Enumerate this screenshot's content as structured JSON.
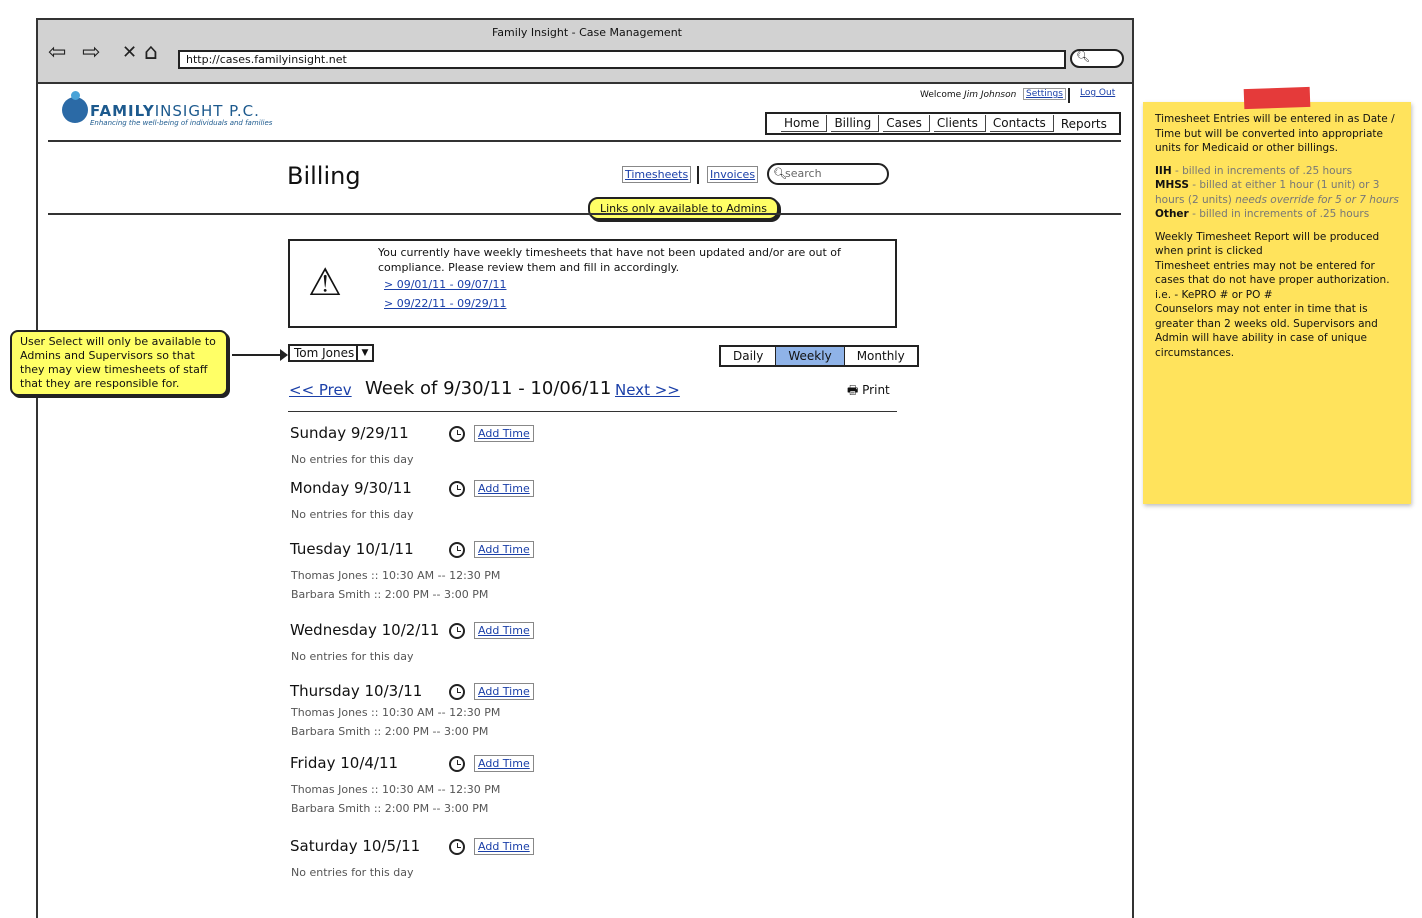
{
  "window": {
    "title": "Family Insight - Case Management",
    "url": "http://cases.familyinsight.net"
  },
  "browser": {
    "back_icon": "⇦",
    "forward_icon": "⇨",
    "stop_icon": "✕",
    "home_icon": "⌂",
    "search_icon": "🔍︎"
  },
  "brand": {
    "name_bold": "FAMILY",
    "name_thin": "INSIGHT P.C.",
    "tagline": "Enhancing the well-being of individuals and families"
  },
  "header": {
    "welcome": "Welcome",
    "user_name": "Jim Johnson",
    "settings": "Settings",
    "logout": "Log Out"
  },
  "nav": {
    "items": [
      "Home",
      "Billing",
      "Cases",
      "Clients",
      "Contacts",
      "Reports"
    ]
  },
  "page": {
    "title": "Billing",
    "timesheets_link": "Timesheets",
    "invoices_link": "Invoices",
    "search_placeholder": "search",
    "admin_note": "Links only available to Admins"
  },
  "alert": {
    "message": "You currently have weekly timesheets that have not been updated and/or are out of compliance. Please review them and fill in accordingly.",
    "links": [
      "> 09/01/11 - 09/07/11",
      "> 09/22/11 - 09/29/11"
    ]
  },
  "user_note": "User Select will only be available to Admins and Supervisors so that they may view timesheets of staff that they are responsible for.",
  "user_select": {
    "value": "Tom Jones"
  },
  "view_toggle": {
    "options": [
      "Daily",
      "Weekly",
      "Monthly"
    ],
    "selected": "Weekly",
    "active_color": "#8fb3e8"
  },
  "week": {
    "prev": "<< Prev",
    "label": "Week of 9/30/11 - 10/06/11",
    "next": "Next >>",
    "print": "Print"
  },
  "add_time_label": "Add Time",
  "days": [
    {
      "title": "Sunday 9/29/11",
      "entries": [
        "No entries for this day"
      ]
    },
    {
      "title": "Monday 9/30/11",
      "entries": [
        "No entries for this day"
      ]
    },
    {
      "title": "Tuesday 10/1/11",
      "entries": [
        "Thomas Jones :: 10:30 AM -- 12:30 PM",
        "Barbara Smith :: 2:00 PM -- 3:00 PM"
      ]
    },
    {
      "title": "Wednesday 10/2/11",
      "entries": [
        "No entries for this day"
      ]
    },
    {
      "title": "Thursday 10/3/11",
      "entries": [
        "Thomas Jones :: 10:30 AM -- 12:30 PM",
        "Barbara Smith :: 2:00 PM -- 3:00 PM"
      ]
    },
    {
      "title": "Friday 10/4/11",
      "entries": [
        "Thomas Jones :: 10:30 AM -- 12:30 PM",
        "Barbara Smith :: 2:00 PM -- 3:00 PM"
      ]
    },
    {
      "title": "Saturday 10/5/11",
      "entries": [
        "No entries for this day"
      ]
    }
  ],
  "sticky": {
    "intro": "Timesheet Entries will be entered in as Date / Time but will be converted into appropriate units for Medicaid or other billings.",
    "iih_label": "IIH",
    "iih_text": " - billed in increments of .25 hours",
    "mhss_label": "MHSS",
    "mhss_text": " - billed at either 1 hour (1 unit) or 3 hours (2 units) ",
    "mhss_italic": "needs override for 5 or 7 hours",
    "other_label": "Other",
    "other_text": " - billed in increments of .25 hours",
    "report": "Weekly Timesheet Report will be produced when print is clicked",
    "auth": "Timesheet entries may not be entered for cases that do not have proper authorization. i.e. - KePRO # or PO #",
    "counselors": "Counselors may not enter in time that is greater than 2 weeks old. Supervisors and Admin will have ability in case of unique circumstances."
  }
}
